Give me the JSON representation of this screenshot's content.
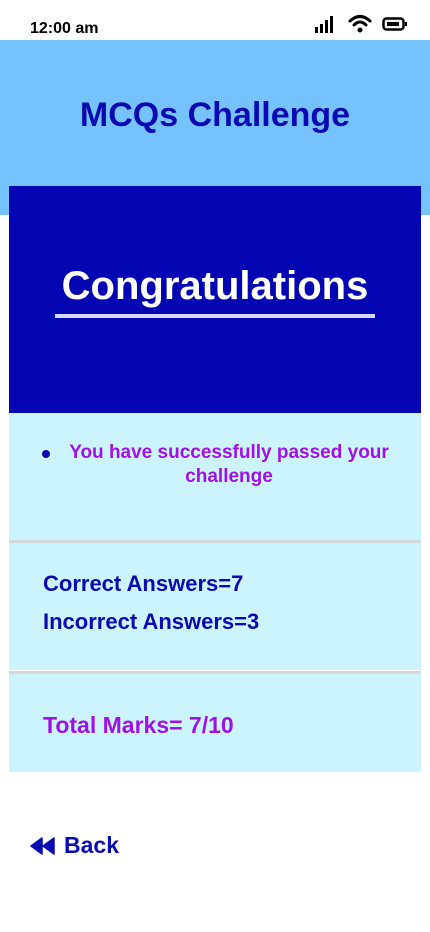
{
  "status_bar": {
    "time": "12:00 am",
    "icons": [
      "signal-icon",
      "wifi-icon",
      "battery-icon"
    ]
  },
  "header": {
    "title": "MCQs Challenge"
  },
  "banner": {
    "title": "Congratulations"
  },
  "result": {
    "message": "You have successfully passed your challenge",
    "correct": "Correct Answers=7",
    "incorrect": "Incorrect Answers=3",
    "total": "Total Marks= 7/10"
  },
  "navigation": {
    "back_label": "Back",
    "back_icon": "rewind-icon"
  },
  "colors": {
    "header_bg": "#76c2ff",
    "banner_bg": "#0505b3",
    "panel_bg": "#cbf4fc",
    "primary_text": "#0a0ab3",
    "accent_text": "#a010e8"
  }
}
